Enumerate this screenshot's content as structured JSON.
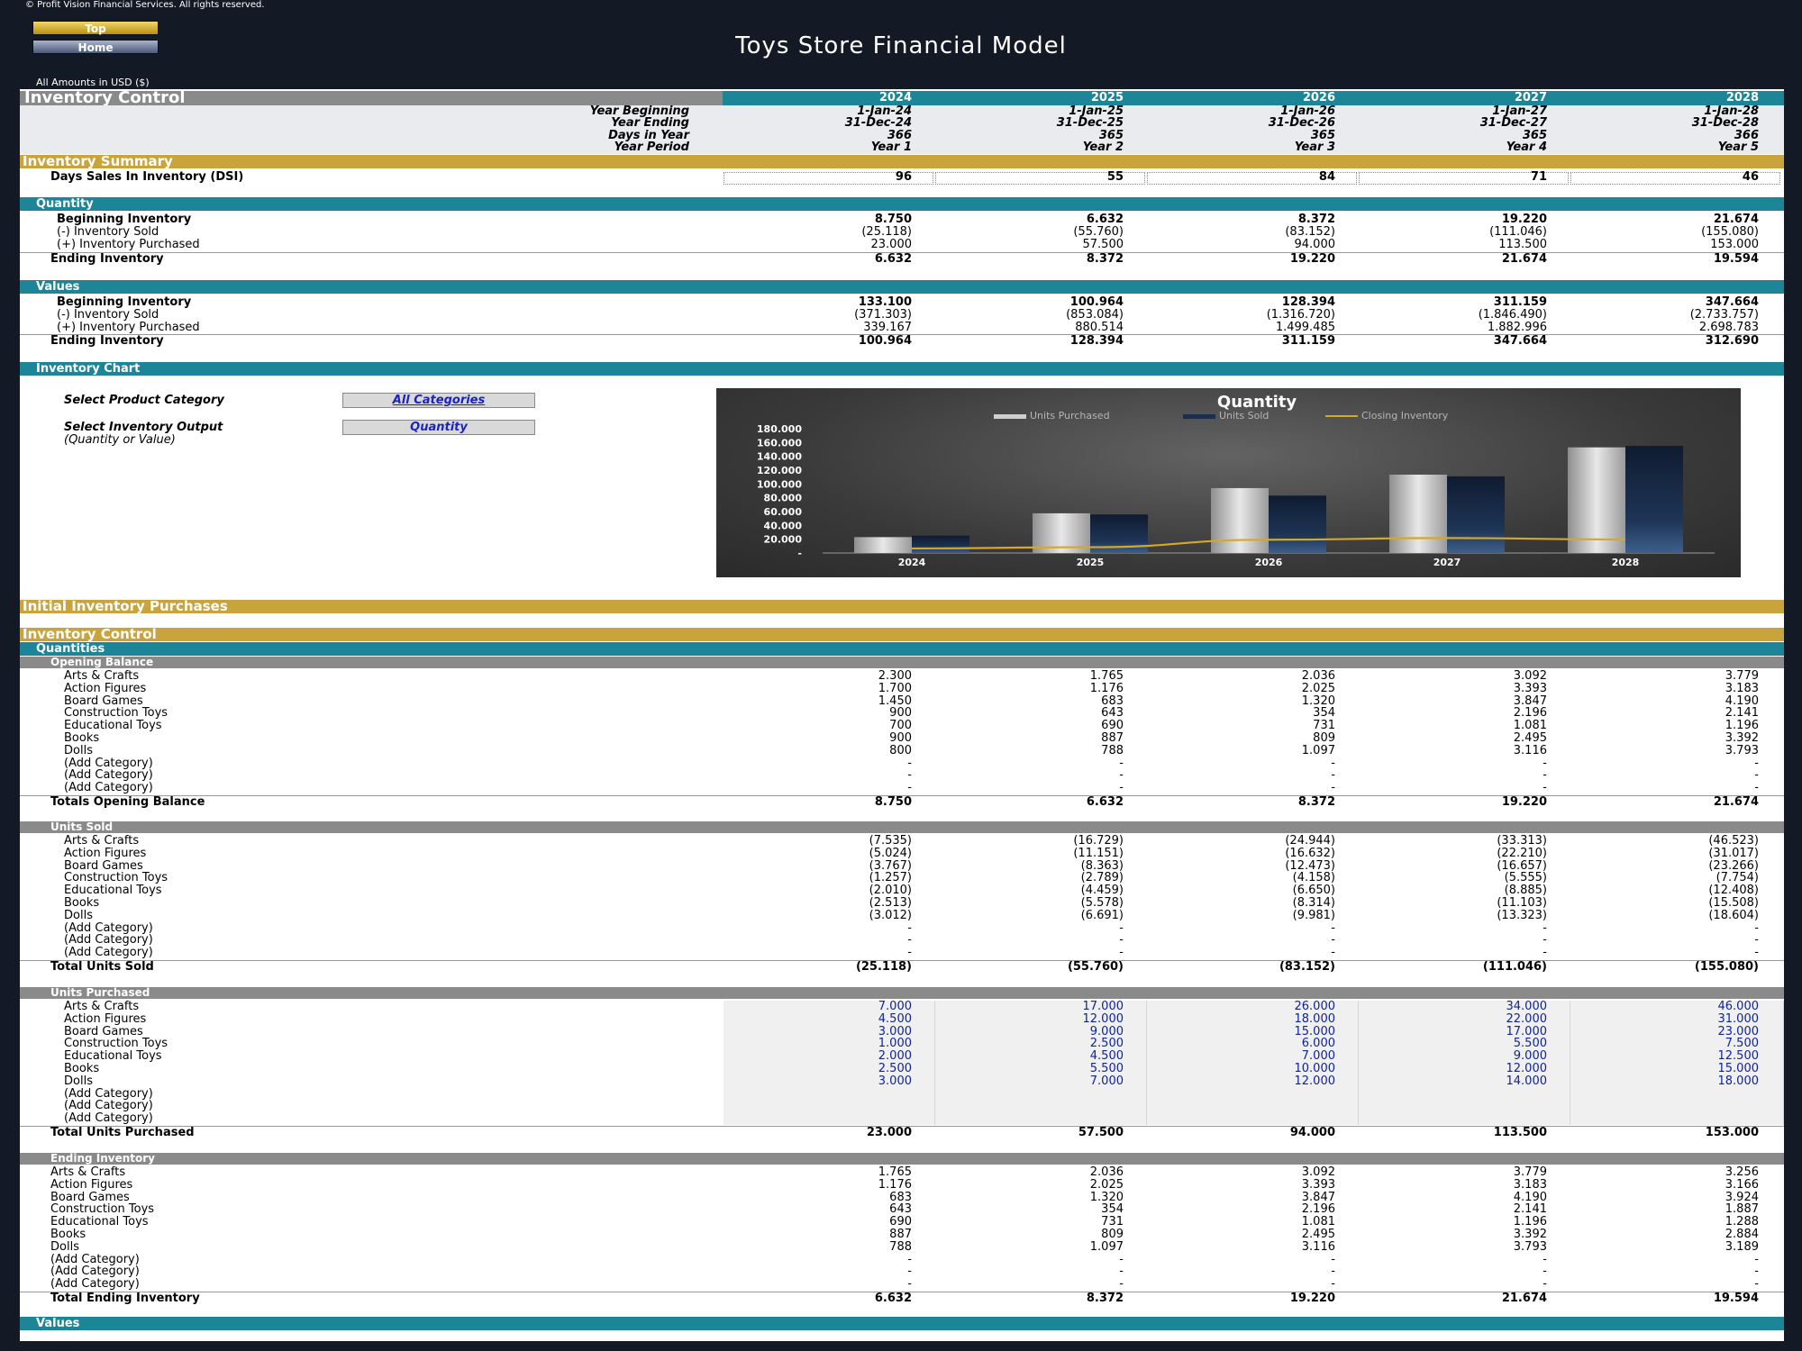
{
  "copyright": "© Profit Vision Financial Services. All rights reserved.",
  "nav": {
    "top": "Top",
    "home": "Home"
  },
  "title": "Toys Store Financial Model",
  "amounts_label": "All Amounts in  USD ($)",
  "years": [
    "2024",
    "2025",
    "2026",
    "2027",
    "2028"
  ],
  "period_rows": [
    {
      "label": "Year Beginning",
      "values": [
        "1-Jan-24",
        "1-Jan-25",
        "1-Jan-26",
        "1-Jan-27",
        "1-Jan-28"
      ]
    },
    {
      "label": "Year Ending",
      "values": [
        "31-Dec-24",
        "31-Dec-25",
        "31-Dec-26",
        "31-Dec-27",
        "31-Dec-28"
      ]
    },
    {
      "label": "Days in Year",
      "values": [
        "366",
        "365",
        "365",
        "365",
        "366"
      ]
    },
    {
      "label": "Year Period",
      "values": [
        "Year 1",
        "Year 2",
        "Year 3",
        "Year 4",
        "Year 5"
      ]
    }
  ],
  "headings": {
    "inventory_control": "Inventory Control",
    "inventory_summary": "Inventory Summary",
    "quantity": "Quantity",
    "values": "Values",
    "inventory_chart": "Inventory Chart",
    "initial_purchases": "Initial Inventory Purchases",
    "inventory_control2": "Inventory Control",
    "quantities": "Quantities",
    "opening_balance": "Opening Balance",
    "units_sold": "Units Sold",
    "units_purchased": "Units Purchased",
    "ending_inventory": "Ending Inventory",
    "values_bottom": "Values"
  },
  "dsi": {
    "label": "Days Sales In Inventory (DSI)",
    "values": [
      "96",
      "55",
      "84",
      "71",
      "46"
    ]
  },
  "quantity_rows": [
    {
      "label": "Beginning Inventory",
      "values": [
        "8.750",
        "6.632",
        "8.372",
        "19.220",
        "21.674"
      ]
    },
    {
      "label": "(-) Inventory Sold",
      "values": [
        "(25.118)",
        "(55.760)",
        "(83.152)",
        "(111.046)",
        "(155.080)"
      ]
    },
    {
      "label": "(+) Inventory Purchased",
      "values": [
        "23.000",
        "57.500",
        "94.000",
        "113.500",
        "153.000"
      ]
    },
    {
      "label": "Ending Inventory",
      "values": [
        "6.632",
        "8.372",
        "19.220",
        "21.674",
        "19.594"
      ]
    }
  ],
  "value_rows": [
    {
      "label": "Beginning Inventory",
      "values": [
        "133.100",
        "100.964",
        "128.394",
        "311.159",
        "347.664"
      ]
    },
    {
      "label": "(-) Inventory Sold",
      "values": [
        "(371.303)",
        "(853.084)",
        "(1.316.720)",
        "(1.846.490)",
        "(2.733.757)"
      ]
    },
    {
      "label": "(+) Inventory Purchased",
      "values": [
        "339.167",
        "880.514",
        "1.499.485",
        "1.882.996",
        "2.698.783"
      ]
    },
    {
      "label": "Ending Inventory",
      "values": [
        "100.964",
        "128.394",
        "311.159",
        "347.664",
        "312.690"
      ]
    }
  ],
  "controls": {
    "category_label": "Select Product Category",
    "category_value": "All Categories",
    "output_label": "Select Inventory Output",
    "output_value": "Quantity",
    "output_hint": "(Quantity or Value)"
  },
  "opening_rows": [
    {
      "label": "Arts & Crafts",
      "values": [
        "2.300",
        "1.765",
        "2.036",
        "3.092",
        "3.779"
      ]
    },
    {
      "label": "Action Figures",
      "values": [
        "1.700",
        "1.176",
        "2.025",
        "3.393",
        "3.183"
      ]
    },
    {
      "label": "Board Games",
      "values": [
        "1.450",
        "683",
        "1.320",
        "3.847",
        "4.190"
      ]
    },
    {
      "label": "Construction Toys",
      "values": [
        "900",
        "643",
        "354",
        "2.196",
        "2.141"
      ]
    },
    {
      "label": "Educational Toys",
      "values": [
        "700",
        "690",
        "731",
        "1.081",
        "1.196"
      ]
    },
    {
      "label": "Books",
      "values": [
        "900",
        "887",
        "809",
        "2.495",
        "3.392"
      ]
    },
    {
      "label": "Dolls",
      "values": [
        "800",
        "788",
        "1.097",
        "3.116",
        "3.793"
      ]
    },
    {
      "label": "(Add Category)",
      "values": [
        "-",
        "-",
        "-",
        "-",
        "-"
      ]
    },
    {
      "label": "(Add Category)",
      "values": [
        "-",
        "-",
        "-",
        "-",
        "-"
      ]
    },
    {
      "label": "(Add Category)",
      "values": [
        "-",
        "-",
        "-",
        "-",
        "-"
      ]
    }
  ],
  "opening_total": {
    "label": "Totals Opening Balance",
    "values": [
      "8.750",
      "6.632",
      "8.372",
      "19.220",
      "21.674"
    ]
  },
  "sold_rows": [
    {
      "label": "Arts & Crafts",
      "values": [
        "(7.535)",
        "(16.729)",
        "(24.944)",
        "(33.313)",
        "(46.523)"
      ]
    },
    {
      "label": "Action Figures",
      "values": [
        "(5.024)",
        "(11.151)",
        "(16.632)",
        "(22.210)",
        "(31.017)"
      ]
    },
    {
      "label": "Board Games",
      "values": [
        "(3.767)",
        "(8.363)",
        "(12.473)",
        "(16.657)",
        "(23.266)"
      ]
    },
    {
      "label": "Construction Toys",
      "values": [
        "(1.257)",
        "(2.789)",
        "(4.158)",
        "(5.555)",
        "(7.754)"
      ]
    },
    {
      "label": "Educational Toys",
      "values": [
        "(2.010)",
        "(4.459)",
        "(6.650)",
        "(8.885)",
        "(12.408)"
      ]
    },
    {
      "label": "Books",
      "values": [
        "(2.513)",
        "(5.578)",
        "(8.314)",
        "(11.103)",
        "(15.508)"
      ]
    },
    {
      "label": "Dolls",
      "values": [
        "(3.012)",
        "(6.691)",
        "(9.981)",
        "(13.323)",
        "(18.604)"
      ]
    },
    {
      "label": "(Add Category)",
      "values": [
        "-",
        "-",
        "-",
        "-",
        "-"
      ]
    },
    {
      "label": "(Add Category)",
      "values": [
        "-",
        "-",
        "-",
        "-",
        "-"
      ]
    },
    {
      "label": "(Add Category)",
      "values": [
        "-",
        "-",
        "-",
        "-",
        "-"
      ]
    }
  ],
  "sold_total": {
    "label": "Total Units Sold",
    "values": [
      "(25.118)",
      "(55.760)",
      "(83.152)",
      "(111.046)",
      "(155.080)"
    ]
  },
  "purchased_rows": [
    {
      "label": "Arts & Crafts",
      "values": [
        "7.000",
        "17.000",
        "26.000",
        "34.000",
        "46.000"
      ]
    },
    {
      "label": "Action Figures",
      "values": [
        "4.500",
        "12.000",
        "18.000",
        "22.000",
        "31.000"
      ]
    },
    {
      "label": "Board Games",
      "values": [
        "3.000",
        "9.000",
        "15.000",
        "17.000",
        "23.000"
      ]
    },
    {
      "label": "Construction Toys",
      "values": [
        "1.000",
        "2.500",
        "6.000",
        "5.500",
        "7.500"
      ]
    },
    {
      "label": "Educational Toys",
      "values": [
        "2.000",
        "4.500",
        "7.000",
        "9.000",
        "12.500"
      ]
    },
    {
      "label": "Books",
      "values": [
        "2.500",
        "5.500",
        "10.000",
        "12.000",
        "15.000"
      ]
    },
    {
      "label": "Dolls",
      "values": [
        "3.000",
        "7.000",
        "12.000",
        "14.000",
        "18.000"
      ]
    },
    {
      "label": "(Add Category)",
      "values": [
        "",
        "",
        "",
        "",
        ""
      ]
    },
    {
      "label": "(Add Category)",
      "values": [
        "",
        "",
        "",
        "",
        ""
      ]
    },
    {
      "label": "(Add Category)",
      "values": [
        "",
        "",
        "",
        "",
        ""
      ]
    }
  ],
  "purchased_total": {
    "label": "Total Units Purchased",
    "values": [
      "23.000",
      "57.500",
      "94.000",
      "113.500",
      "153.000"
    ]
  },
  "ending_rows": [
    {
      "label": "Arts & Crafts",
      "values": [
        "1.765",
        "2.036",
        "3.092",
        "3.779",
        "3.256"
      ]
    },
    {
      "label": "Action Figures",
      "values": [
        "1.176",
        "2.025",
        "3.393",
        "3.183",
        "3.166"
      ]
    },
    {
      "label": "Board Games",
      "values": [
        "683",
        "1.320",
        "3.847",
        "4.190",
        "3.924"
      ]
    },
    {
      "label": "Construction Toys",
      "values": [
        "643",
        "354",
        "2.196",
        "2.141",
        "1.887"
      ]
    },
    {
      "label": "Educational Toys",
      "values": [
        "690",
        "731",
        "1.081",
        "1.196",
        "1.288"
      ]
    },
    {
      "label": "Books",
      "values": [
        "887",
        "809",
        "2.495",
        "3.392",
        "2.884"
      ]
    },
    {
      "label": "Dolls",
      "values": [
        "788",
        "1.097",
        "3.116",
        "3.793",
        "3.189"
      ]
    },
    {
      "label": "(Add Category)",
      "values": [
        "-",
        "-",
        "-",
        "-",
        "-"
      ]
    },
    {
      "label": "(Add Category)",
      "values": [
        "-",
        "-",
        "-",
        "-",
        "-"
      ]
    },
    {
      "label": "(Add Category)",
      "values": [
        "-",
        "-",
        "-",
        "-",
        "-"
      ]
    }
  ],
  "ending_total": {
    "label": "Total Ending Inventory",
    "values": [
      "6.632",
      "8.372",
      "19.220",
      "21.674",
      "19.594"
    ]
  },
  "colors": {
    "teal": "#1c8597",
    "gold": "#c9a33c",
    "gray": "#8a8a8a",
    "input_blue": "#10239a",
    "navy_bg": "#141a25",
    "closing_line": "#d4a82a"
  },
  "chart_data": {
    "type": "bar",
    "title": "Quantity",
    "categories": [
      "2024",
      "2025",
      "2026",
      "2027",
      "2028"
    ],
    "yticks": [
      "180.000",
      "160.000",
      "140.000",
      "120.000",
      "100.000",
      "80.000",
      "60.000",
      "40.000",
      "20.000",
      "-"
    ],
    "ylim": [
      0,
      180000
    ],
    "legend_position": "top",
    "series": [
      {
        "name": "Units Purchased",
        "kind": "bar",
        "color": "#c9c9c9",
        "values": [
          23000,
          57500,
          94000,
          113500,
          153000
        ]
      },
      {
        "name": "Units Sold",
        "kind": "bar",
        "color": "#1a2a44",
        "values": [
          25118,
          55760,
          83152,
          111046,
          155080
        ]
      },
      {
        "name": "Closing Inventory",
        "kind": "line",
        "color": "#d4a82a",
        "values": [
          6632,
          8372,
          19220,
          21674,
          19594
        ]
      }
    ]
  }
}
